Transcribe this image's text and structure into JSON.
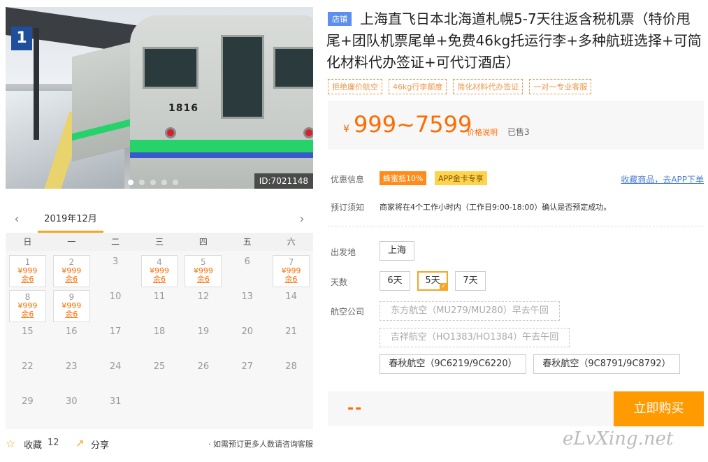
{
  "gallery": {
    "image_id": "ID:7021148",
    "platform_sign": "1",
    "train_number": "1816",
    "slide_count": 5,
    "active_slide": 1
  },
  "calendar": {
    "month_label": "2019年12月",
    "prev_icon": "chevron-left-icon",
    "next_icon": "chevron-right-icon",
    "weekdays": [
      "日",
      "一",
      "二",
      "三",
      "四",
      "五",
      "六"
    ],
    "days": [
      {
        "day": "1",
        "price": "¥999",
        "stock": "余6"
      },
      {
        "day": "2",
        "price": "¥999",
        "stock": "余6"
      },
      {
        "day": "3"
      },
      {
        "day": "4",
        "price": "¥999",
        "stock": "余6"
      },
      {
        "day": "5",
        "price": "¥999",
        "stock": "余6"
      },
      {
        "day": "6"
      },
      {
        "day": "7",
        "price": "¥999",
        "stock": "余6"
      },
      {
        "day": "8",
        "price": "¥999",
        "stock": "余6"
      },
      {
        "day": "9",
        "price": "¥999",
        "stock": "余6"
      },
      {
        "day": "10"
      },
      {
        "day": "11"
      },
      {
        "day": "12"
      },
      {
        "day": "13"
      },
      {
        "day": "14"
      },
      {
        "day": "15"
      },
      {
        "day": "16"
      },
      {
        "day": "17"
      },
      {
        "day": "18"
      },
      {
        "day": "19"
      },
      {
        "day": "20"
      },
      {
        "day": "21"
      },
      {
        "day": "22"
      },
      {
        "day": "23"
      },
      {
        "day": "24"
      },
      {
        "day": "25"
      },
      {
        "day": "26"
      },
      {
        "day": "27"
      },
      {
        "day": "28"
      },
      {
        "day": "29"
      },
      {
        "day": "30"
      },
      {
        "day": "31"
      }
    ]
  },
  "social": {
    "favorite_label": "收藏",
    "favorite_count": "12",
    "share_label": "分享",
    "note": "· 如需预订更多人数请咨询客服"
  },
  "product": {
    "badge": "店铺",
    "title": "上海直飞日本北海道札幌5-7天往返含税机票（特价甩尾+团队机票尾单+免费46kg托运行李+多种航班选择+可简化材料代办签证+可代订酒店）",
    "tags": [
      "拒绝廉价航空",
      "46kg行李额度",
      "简化材料代办签证",
      "一对一专业客服"
    ],
    "currency": "¥",
    "price": "999~7599",
    "price_note": "价格说明",
    "sold": "已售3",
    "promo_label": "优惠信息",
    "promos": [
      "蜂蜜抵10%",
      "APP金卡专享"
    ],
    "app_link": "收藏商品，去APP下单",
    "booking_label": "预订须知",
    "booking_notice": "商家将在4个工作小时内（工作日9:00-18:00）确认是否预定成功。",
    "departure_label": "出发地",
    "departure_options": [
      "上海"
    ],
    "days_label": "天数",
    "days_options": [
      "6天",
      "5天",
      "7天"
    ],
    "days_selected": "5天",
    "airline_label": "航空公司",
    "airline_options": [
      "东方航空（MU279/MU280）早去午回",
      "吉祥航空（HO1383/HO1384）午去午回",
      "春秋航空（9C6219/9C6220）",
      "春秋航空（9C8791/9C8792）"
    ],
    "total_placeholder": "--",
    "buy_label": "立即购买"
  },
  "watermark": "eLvXing.net",
  "colors": {
    "accent": "#ff9a00",
    "price": "#ff6b00",
    "badge": "#5b8ff0",
    "link": "#4a7fd1"
  }
}
